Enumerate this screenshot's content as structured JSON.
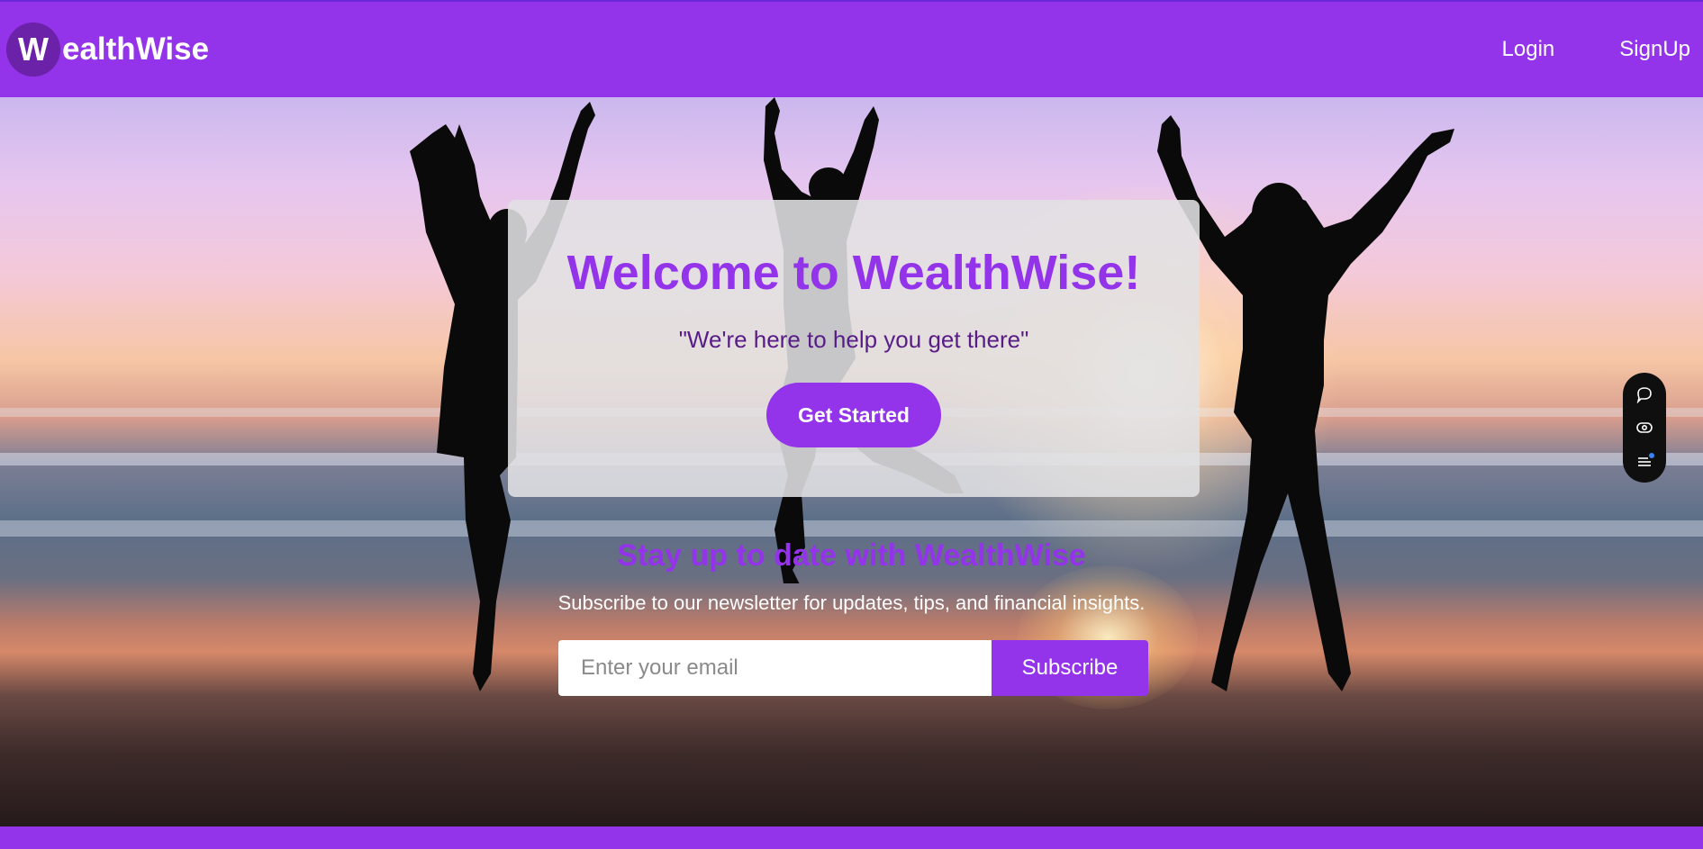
{
  "brand": {
    "badge": "W",
    "rest": "ealthWise"
  },
  "nav": {
    "login": "Login",
    "signup": "SignUp"
  },
  "hero": {
    "title": "Welcome to WealthWise!",
    "tagline": "\"We're here to help you get there\"",
    "cta_label": "Get Started"
  },
  "newsletter": {
    "title": "Stay up to date with WealthWise",
    "description": "Subscribe to our newsletter for updates, tips, and financial insights.",
    "email_placeholder": "Enter your email",
    "subscribe_label": "Subscribe"
  },
  "side_toolbar": {
    "icons": [
      "chat-bubble-icon",
      "eye-icon",
      "list-icon"
    ]
  },
  "colors": {
    "brand_purple": "#9333ea",
    "dark_purple": "#581c87",
    "badge_purple": "#6b21a8"
  }
}
